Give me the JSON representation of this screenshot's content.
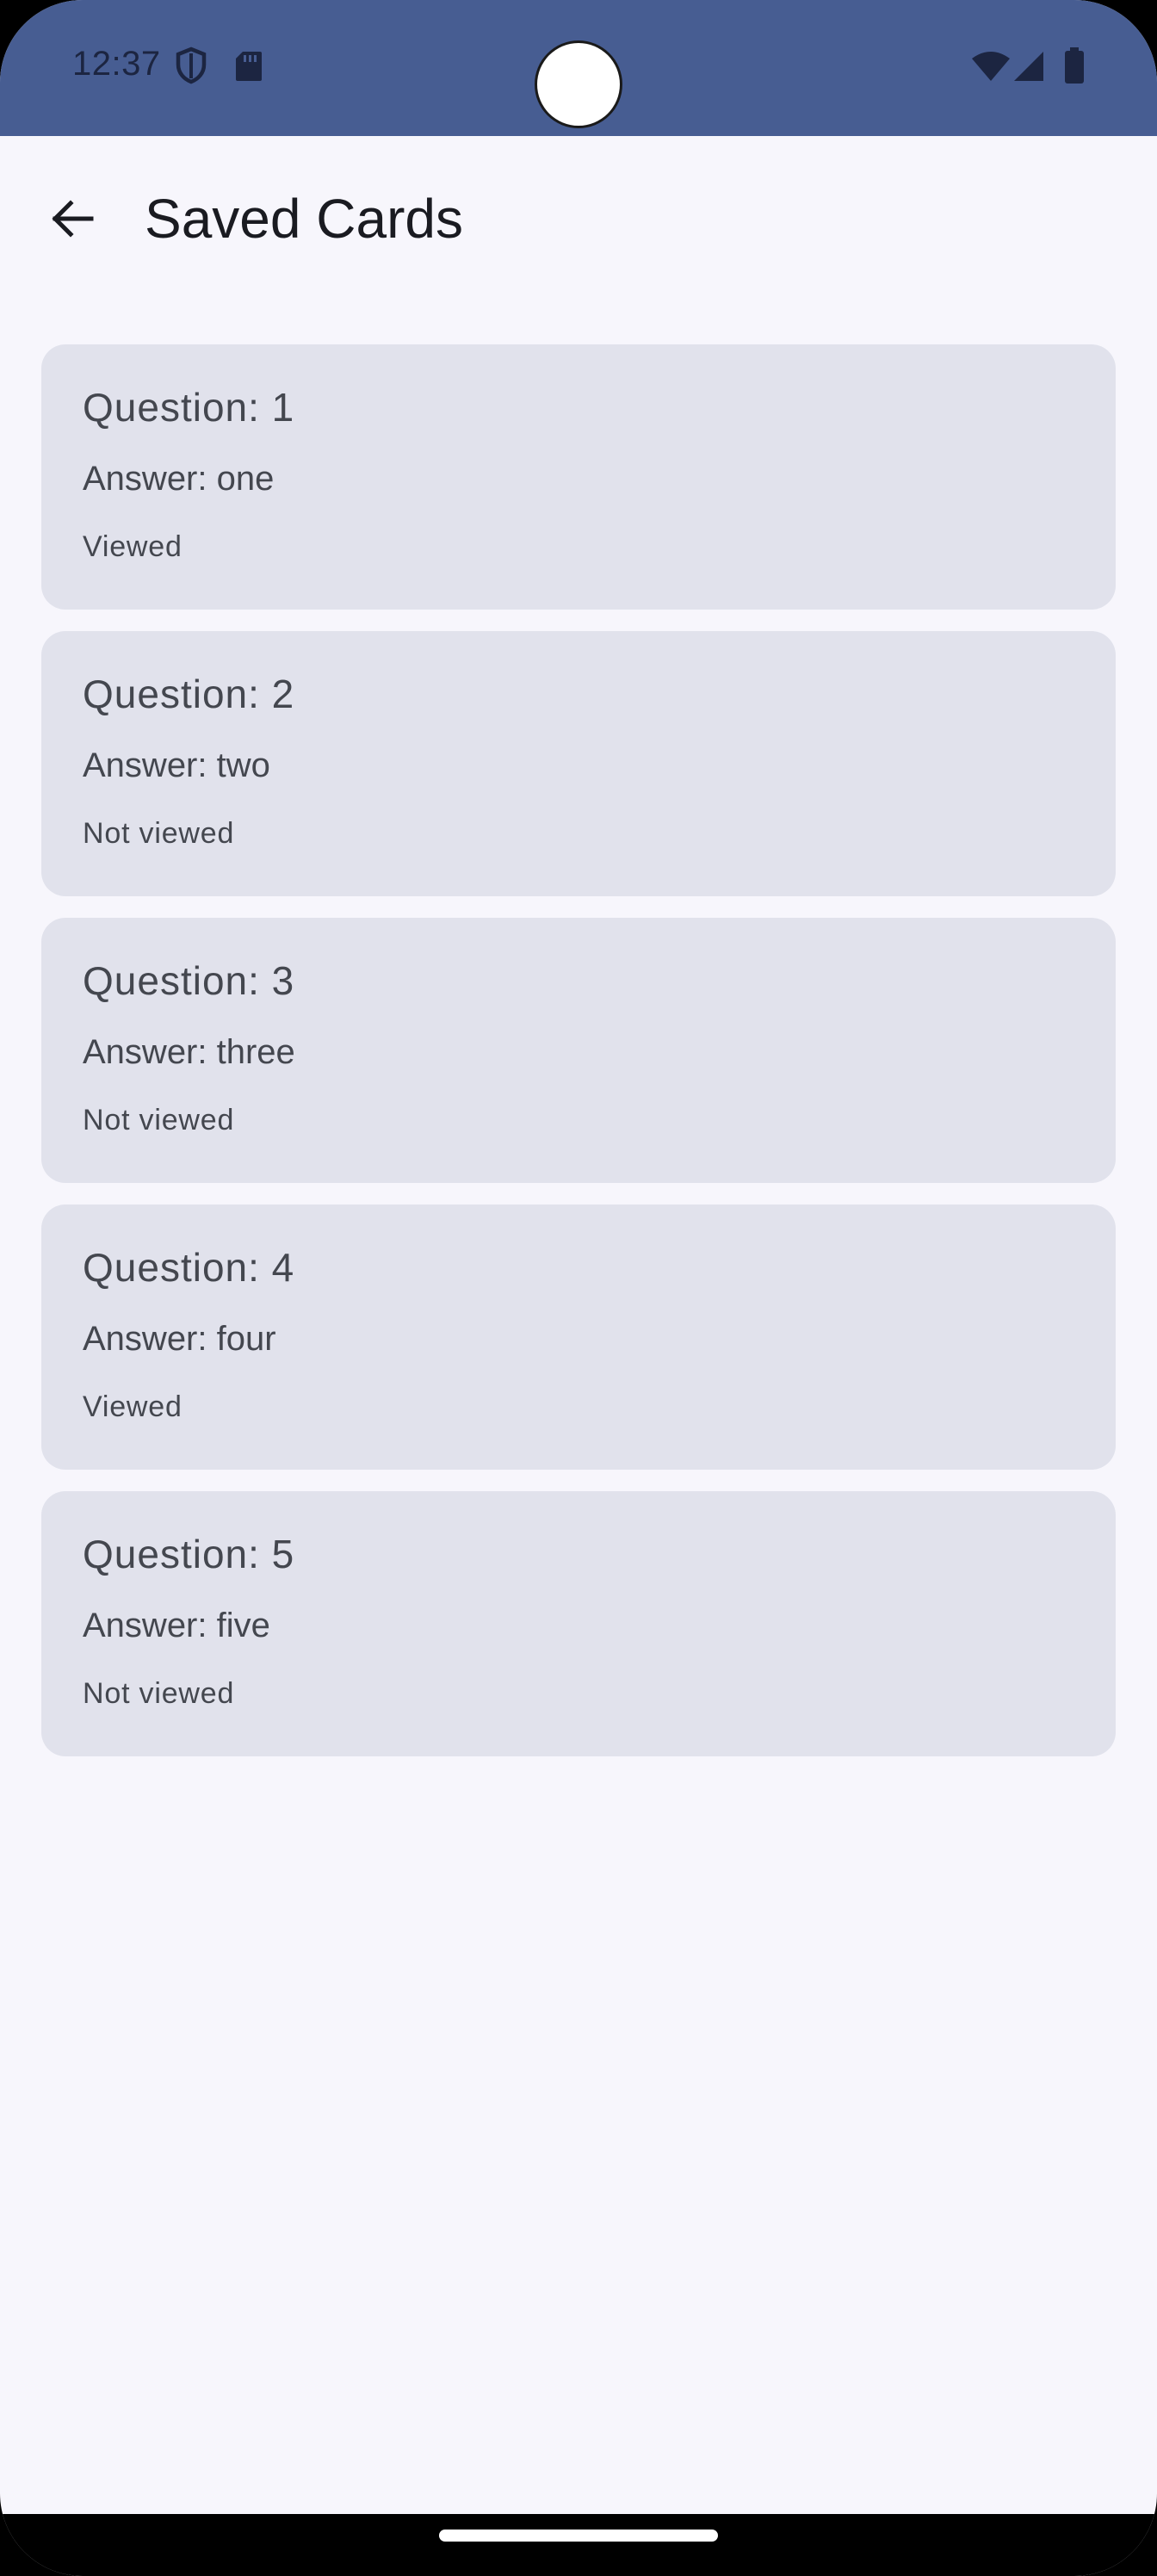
{
  "status_bar": {
    "time": "12:37",
    "icons": [
      "shield-icon",
      "sd-card-icon",
      "wifi-icon",
      "cell-signal-icon",
      "battery-icon"
    ],
    "color": "#475d92"
  },
  "app_bar": {
    "title": "Saved Cards",
    "back_icon": "arrow-back-icon"
  },
  "cards": [
    {
      "question": "Question: 1",
      "answer": "Answer: one",
      "status": "Viewed"
    },
    {
      "question": "Question: 2",
      "answer": "Answer: two",
      "status": "Not viewed"
    },
    {
      "question": "Question: 3",
      "answer": "Answer: three",
      "status": "Not viewed"
    },
    {
      "question": "Question: 4",
      "answer": "Answer: four",
      "status": "Viewed"
    },
    {
      "question": "Question: 5",
      "answer": "Answer: five",
      "status": "Not viewed"
    }
  ],
  "colors": {
    "background": "#f7f6fc",
    "card": "#e1e2ec",
    "text": "#44474f",
    "title": "#1a1b21"
  }
}
